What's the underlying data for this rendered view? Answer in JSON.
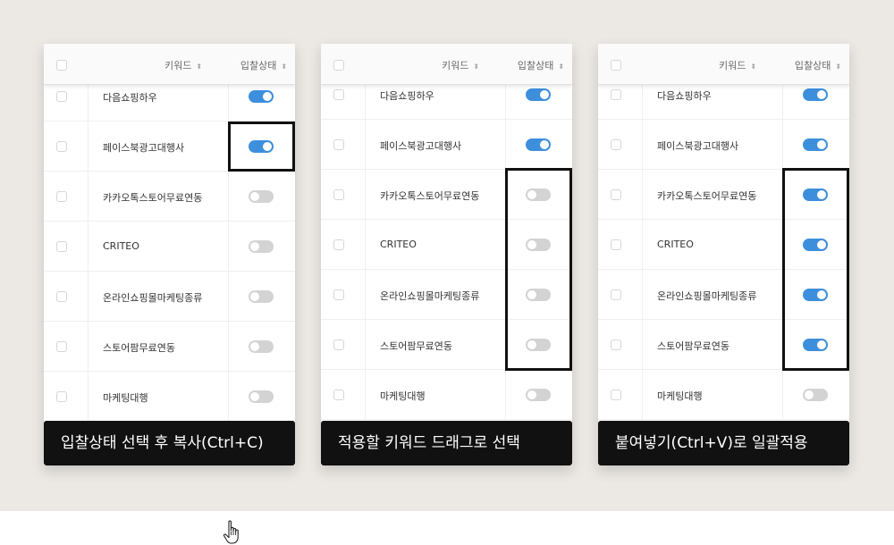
{
  "header": {
    "col_keyword": "키워드",
    "col_status": "입찰상태",
    "sort_glyph": "⬍"
  },
  "rows": [
    {
      "keyword": "다음쇼핑하우"
    },
    {
      "keyword": "페이스북광고대행사"
    },
    {
      "keyword": "카카오톡스토어무료연동"
    },
    {
      "keyword": "CRITEO"
    },
    {
      "keyword": "온라인쇼핑몰마케팅종류"
    },
    {
      "keyword": "스토어팜무료연동"
    },
    {
      "keyword": "마케팅대행"
    }
  ],
  "panels": [
    {
      "caption": "입찰상태 선택 후 복사(Ctrl+C)",
      "toggles_on": [
        true,
        true,
        false,
        false,
        false,
        false,
        false
      ]
    },
    {
      "caption": "적용할 키워드 드래그로 선택",
      "toggles_on": [
        true,
        true,
        false,
        false,
        false,
        false,
        false
      ]
    },
    {
      "caption": "붙여넣기(Ctrl+V)로 일괄적용",
      "toggles_on": [
        true,
        true,
        true,
        true,
        true,
        true,
        false
      ]
    }
  ],
  "colors": {
    "toggle_on": "#3d8fdc",
    "toggle_off": "#d3d3d3",
    "caption_bg": "#111111",
    "stage_bg": "#ece9e4"
  },
  "icons": {
    "cursor": "hand-pointer-icon"
  }
}
